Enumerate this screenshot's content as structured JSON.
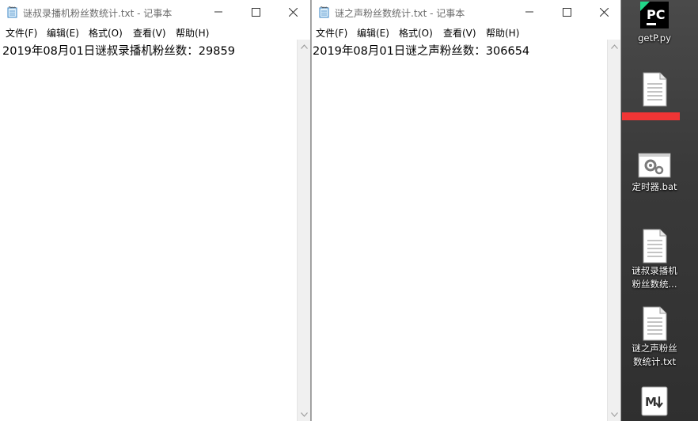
{
  "windows": [
    {
      "title": "谜叔录播机粉丝数统计.txt - 记事本",
      "menu": [
        "文件(F)",
        "编辑(E)",
        "格式(O)",
        "查看(V)",
        "帮助(H)"
      ],
      "content": "2019年08月01日谜叔录播机粉丝数：29859"
    },
    {
      "title": "谜之声粉丝数统计.txt - 记事本",
      "menu": [
        "文件(F)",
        "编辑(E)",
        "格式(O)",
        "查看(V)",
        "帮助(H)"
      ],
      "content": "2019年08月01日谜之声粉丝数：306654"
    }
  ],
  "desktop": {
    "icons": [
      {
        "name": "pycharm-file-icon",
        "label_lines": [
          "getP.py"
        ]
      },
      {
        "name": "text-file-icon",
        "label_lines": [
          ""
        ],
        "redacted": true
      },
      {
        "name": "batch-file-icon",
        "label_lines": [
          "定时器.bat"
        ]
      },
      {
        "name": "text-file-icon",
        "label_lines": [
          "谜叔录播机",
          "粉丝数统..."
        ]
      },
      {
        "name": "text-file-icon",
        "label_lines": [
          "谜之声粉丝",
          "数统计.txt"
        ]
      },
      {
        "name": "markdown-file-icon",
        "label_lines": []
      }
    ]
  },
  "colors": {
    "desktop": "#3d3d3d",
    "window_bg": "#ffffff",
    "redaction": "#f03535",
    "pycharm_green": "#21d789"
  }
}
